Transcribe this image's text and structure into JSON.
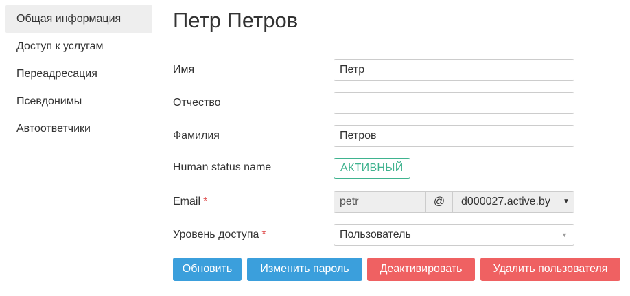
{
  "sidebar": {
    "items": [
      {
        "label": "Общая информация",
        "active": true
      },
      {
        "label": "Доступ к услугам",
        "active": false
      },
      {
        "label": "Переадресация",
        "active": false
      },
      {
        "label": "Псевдонимы",
        "active": false
      },
      {
        "label": "Автоответчики",
        "active": false
      }
    ]
  },
  "main": {
    "title": "Петр Петров",
    "form": {
      "first_name": {
        "label": "Имя",
        "value": "Петр"
      },
      "middle_name": {
        "label": "Отчество",
        "value": ""
      },
      "last_name": {
        "label": "Фамилия",
        "value": "Петров"
      },
      "status": {
        "label": "Human status name",
        "value": "АКТИВНЫЙ"
      },
      "email": {
        "label": "Email",
        "required_mark": "*",
        "local_part": "petr",
        "at": "@",
        "domain": "d000027.active.by"
      },
      "access_level": {
        "label": "Уровень доступа",
        "required_mark": "*",
        "value": "Пользователь"
      }
    },
    "buttons": {
      "update": "Обновить",
      "change_password": "Изменить пароль",
      "deactivate": "Деактивировать",
      "delete_user": "Удалить пользователя"
    }
  },
  "colors": {
    "primary": "#3b9fdc",
    "danger": "#ef6162",
    "status_active": "#3fb38f",
    "required": "#e05252",
    "sidebar_active_bg": "#eeeeee"
  }
}
